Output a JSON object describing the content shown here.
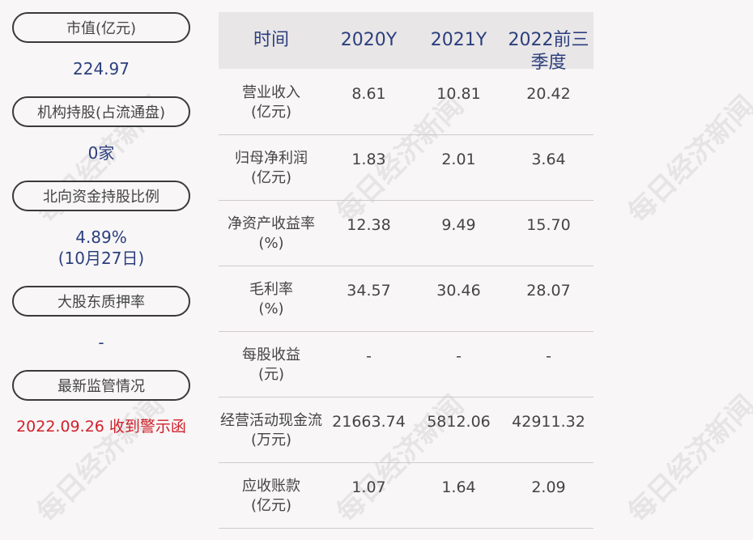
{
  "left_panel": {
    "items": [
      {
        "label": "市值(亿元)",
        "value": "224.97",
        "value2": ""
      },
      {
        "label": "机构持股(占流通盘)",
        "value": "0家",
        "value2": ""
      },
      {
        "label": "北向资金持股比例",
        "value": "4.89%",
        "value2": "(10月27日)"
      },
      {
        "label": "大股东质押率",
        "value": "-",
        "value2": ""
      },
      {
        "label": "最新监管情况",
        "value": "2022.09.26 收到警示函",
        "value2": ""
      }
    ],
    "alert_color": "#d0202a",
    "value_color": "#2b3f7d"
  },
  "table": {
    "headers": [
      "时间",
      "2020Y",
      "2021Y",
      "2022前三季度"
    ],
    "rows": [
      {
        "label1": "营业收入",
        "label2": "(亿元)",
        "values": [
          "8.61",
          "10.81",
          "20.42"
        ]
      },
      {
        "label1": "归母净利润",
        "label2": "(亿元)",
        "values": [
          "1.83",
          "2.01",
          "3.64"
        ]
      },
      {
        "label1": "净资产收益率",
        "label2": "(%)",
        "values": [
          "12.38",
          "9.49",
          "15.70"
        ]
      },
      {
        "label1": "毛利率",
        "label2": "(%)",
        "values": [
          "34.57",
          "30.46",
          "28.07"
        ]
      },
      {
        "label1": "每股收益",
        "label2": "(元)",
        "values": [
          "-",
          "-",
          "-"
        ]
      },
      {
        "label1": "经营活动现金流",
        "label2": "(万元)",
        "values": [
          "21663.74",
          "5812.06",
          "42911.32"
        ]
      },
      {
        "label1": "应收账款",
        "label2": "(亿元)",
        "values": [
          "1.07",
          "1.64",
          "2.09"
        ]
      }
    ]
  },
  "watermark": "每日经济新闻"
}
